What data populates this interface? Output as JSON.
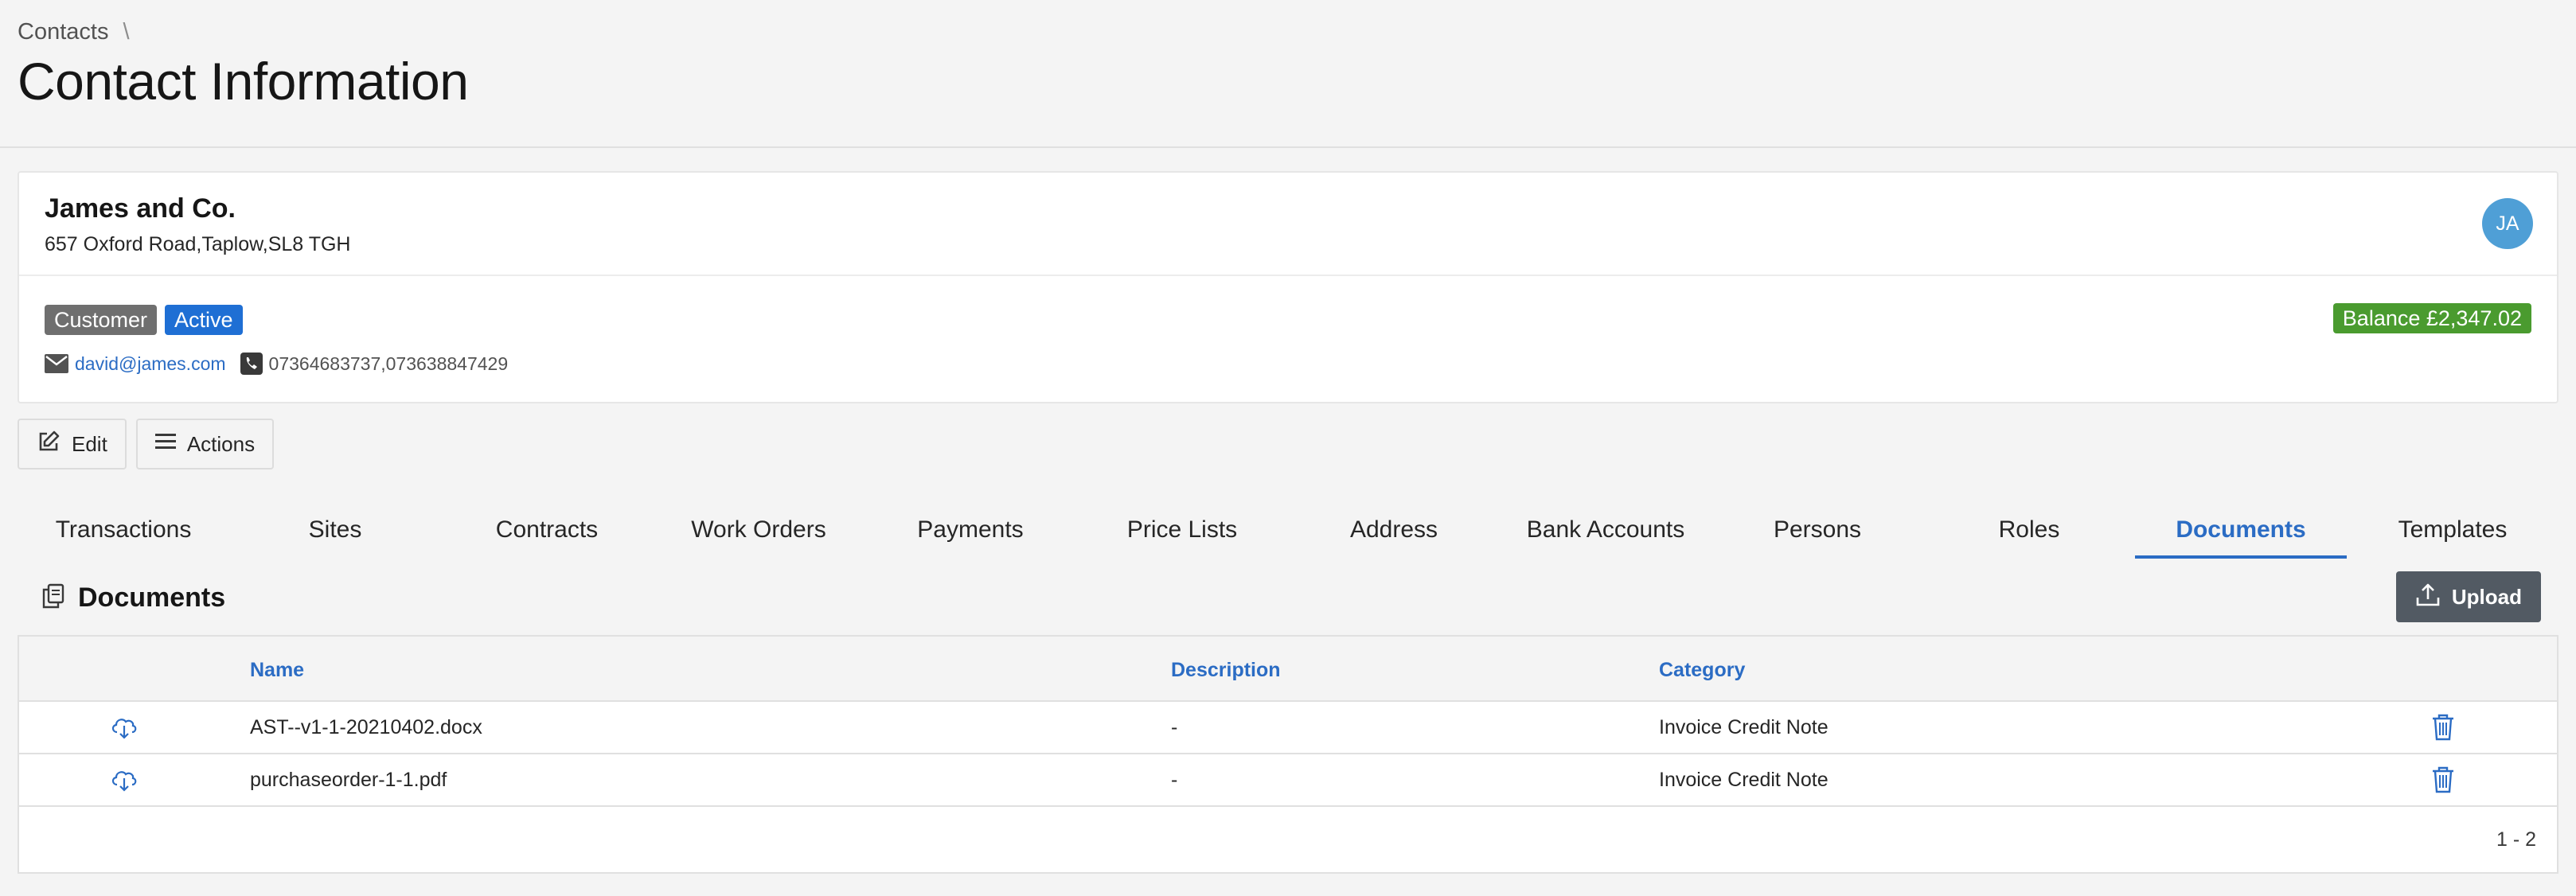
{
  "breadcrumb": {
    "parent": "Contacts",
    "separator": "\\"
  },
  "page": {
    "title": "Contact Information"
  },
  "contact": {
    "name": "James and Co.",
    "address": "657 Oxford Road,Taplow,SL8 TGH",
    "avatar_initials": "JA",
    "tags": {
      "customer": "Customer",
      "active": "Active"
    },
    "balance": "Balance £2,347.02",
    "email": "david@james.com",
    "phones": "07364683737,073638847429"
  },
  "actions": {
    "edit_label": "Edit",
    "actions_label": "Actions"
  },
  "tabs": [
    {
      "label": "Transactions"
    },
    {
      "label": "Sites"
    },
    {
      "label": "Contracts"
    },
    {
      "label": "Work Orders"
    },
    {
      "label": "Payments"
    },
    {
      "label": "Price Lists"
    },
    {
      "label": "Address"
    },
    {
      "label": "Bank Accounts"
    },
    {
      "label": "Persons"
    },
    {
      "label": "Roles"
    },
    {
      "label": "Documents"
    },
    {
      "label": "Templates"
    }
  ],
  "documents": {
    "title": "Documents",
    "upload_label": "Upload",
    "columns": {
      "name": "Name",
      "description": "Description",
      "category": "Category"
    },
    "rows": [
      {
        "name": "AST--v1-1-20210402.docx",
        "description": "-",
        "category": "Invoice Credit Note"
      },
      {
        "name": "purchaseorder-1-1.pdf",
        "description": "-",
        "category": "Invoice Credit Note"
      }
    ],
    "pagination": "1 - 2"
  },
  "colors": {
    "accent": "#2b6cc4",
    "avatar": "#4f9fd6",
    "active_tag": "#1f6fd4",
    "customer_tag": "#6f6f6f",
    "balance": "#4a9b2f",
    "upload_button": "#525a63"
  },
  "icons": {
    "email": "envelope-icon",
    "phone": "phone-icon",
    "edit": "pencil-edit-icon",
    "actions": "list-menu-icon",
    "documents": "copy-documents-icon",
    "upload": "upload-icon",
    "download": "cloud-download-icon",
    "delete": "trash-icon"
  }
}
